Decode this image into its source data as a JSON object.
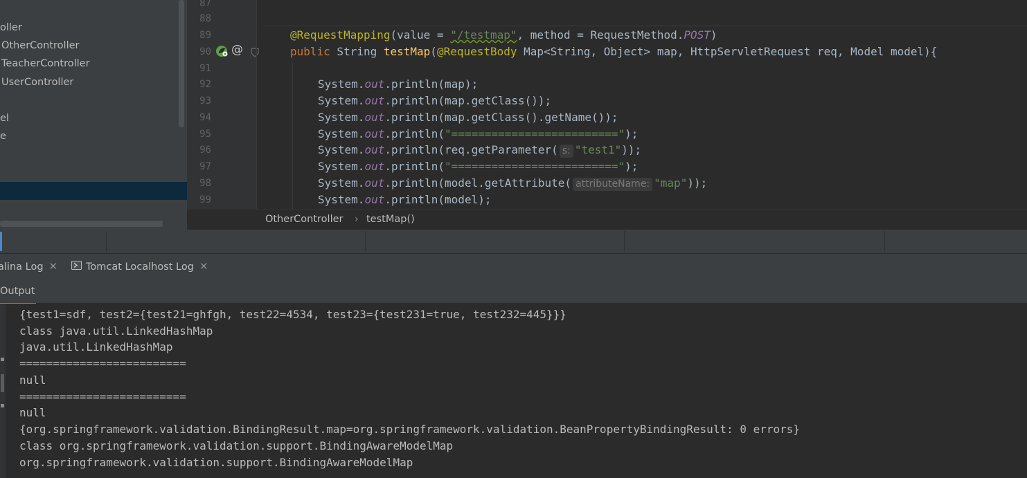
{
  "project_tree": {
    "items": [
      {
        "label": "oller"
      },
      {
        "label": "OtherController"
      },
      {
        "label": "TeacherController"
      },
      {
        "label": "UserController"
      },
      {
        "label": "el"
      },
      {
        "label": "e"
      }
    ]
  },
  "editor": {
    "line_numbers": [
      "87",
      "88",
      "89",
      "90",
      "91",
      "92",
      "93",
      "94",
      "95",
      "96",
      "97",
      "98",
      "99"
    ],
    "code": {
      "l89": {
        "ann": "@RequestMapping",
        "p1": "(value = ",
        "str": "\"/testmap\"",
        "p2": ", method = RequestMethod.",
        "st": "POST",
        "p3": ")"
      },
      "l90": {
        "kw": "public",
        "p1": " String ",
        "fn": "testMap",
        "p2": "(",
        "ann": "@RequestBody",
        "p3": " Map<String, Object> map, HttpServletRequest req, Model model){"
      },
      "l92": {
        "p1": "System.",
        "st": "out",
        "p2": ".println(map);"
      },
      "l93": {
        "p1": "System.",
        "st": "out",
        "p2": ".println(map.getClass());"
      },
      "l94": {
        "p1": "System.",
        "st": "out",
        "p2": ".println(map.getClass().getName());"
      },
      "l95": {
        "p1": "System.",
        "st": "out",
        "p2": ".println(",
        "str": "\"=========================\"",
        "p3": ");"
      },
      "l96": {
        "p1": "System.",
        "st": "out",
        "p2": ".println(req.getParameter(",
        "hint": "s:",
        "str": "\"test1\"",
        "p3": "));"
      },
      "l97": {
        "p1": "System.",
        "st": "out",
        "p2": ".println(",
        "str": "\"=========================\"",
        "p3": ");"
      },
      "l98": {
        "p1": "System.",
        "st": "out",
        "p2": ".println(model.getAttribute(",
        "hint": "attributeName:",
        "str": "\"map\"",
        "p3": "));"
      },
      "l99": {
        "p1": "System.",
        "st": "out",
        "p2": ".println(model);"
      }
    }
  },
  "breadcrumb": {
    "class_name": "OtherController",
    "separator": "›",
    "method_name": "testMap()"
  },
  "log_tabs": [
    {
      "label": "alina Log",
      "close": "✕"
    },
    {
      "label": "Tomcat Localhost Log",
      "close": "✕"
    }
  ],
  "output_tab": {
    "label": "Output"
  },
  "console": {
    "lines": [
      "{test1=sdf, test2={test21=ghfgh, test22=4534, test23={test231=true, test232=445}}}",
      "class java.util.LinkedHashMap",
      "java.util.LinkedHashMap",
      "=========================",
      "null",
      "=========================",
      "null",
      "{org.springframework.validation.BindingResult.map=org.springframework.validation.BeanPropertyBindingResult: 0 errors}",
      "class org.springframework.validation.support.BindingAwareModelMap",
      "org.springframework.validation.support.BindingAwareModelMap"
    ]
  },
  "colors": {
    "editor_bg": "#2b2b2b",
    "panel_bg": "#3c3f41",
    "selection": "#0d293e",
    "keyword": "#cc7832",
    "annotation": "#bbb529",
    "string": "#6a8759",
    "static_field": "#9876aa",
    "method_decl": "#ffc66d"
  }
}
